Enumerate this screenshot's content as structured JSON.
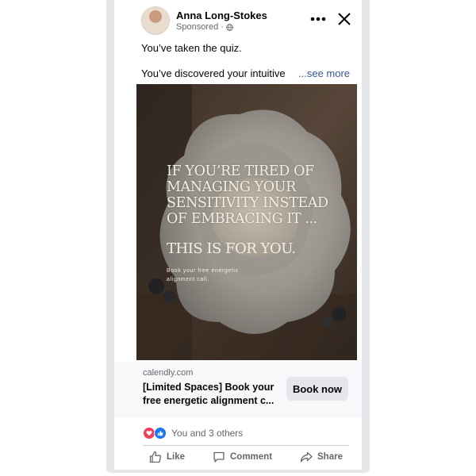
{
  "post": {
    "author": "Anna Long-Stokes",
    "sponsored": "Sponsored ·",
    "more_icon": "more-dots-icon",
    "close_icon": "close-icon",
    "text_line1": "You’ve taken the quiz.",
    "text_line2": "You’ve discovered your intuitive",
    "see_more": "...see more"
  },
  "creative": {
    "headline": "IF YOU’RE TIRED OF MANAGING YOUR SENSITIVITY INSTEAD OF EMBRACING IT ...",
    "subhead": "THIS IS FOR YOU.",
    "small_text": "Book your free energetic alignment call."
  },
  "link": {
    "domain": "calendly.com",
    "title": "[Limited Spaces] Book your free energetic alignment c...",
    "cta": "Book now"
  },
  "reactions": {
    "count_text": "You and 3 others",
    "types": [
      "love",
      "like"
    ],
    "colors": {
      "love": "#f33e58",
      "like": "#1877f2"
    }
  },
  "actions": [
    {
      "label": "Like",
      "icon": "thumbs-up-icon"
    },
    {
      "label": "Comment",
      "icon": "comment-icon"
    },
    {
      "label": "Share",
      "icon": "share-icon"
    }
  ]
}
